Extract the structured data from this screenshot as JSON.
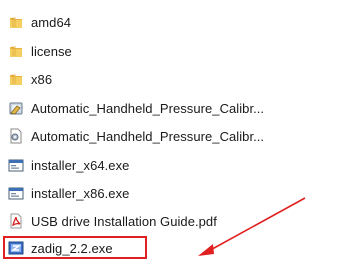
{
  "files": [
    {
      "name": "amd64",
      "icon": "folder-icon"
    },
    {
      "name": "license",
      "icon": "folder-icon"
    },
    {
      "name": "x86",
      "icon": "folder-icon"
    },
    {
      "name": "Automatic_Handheld_Pressure_Calibr...",
      "icon": "application-icon"
    },
    {
      "name": "Automatic_Handheld_Pressure_Calibr...",
      "icon": "setup-file-icon"
    },
    {
      "name": "installer_x64.exe",
      "icon": "exe-window-icon"
    },
    {
      "name": "installer_x86.exe",
      "icon": "exe-window-icon"
    },
    {
      "name": "USB drive Installation Guide.pdf",
      "icon": "pdf-icon"
    },
    {
      "name": "zadig_2.2.exe",
      "icon": "zadig-app-icon"
    }
  ],
  "colors": {
    "folder": "#f2c14e",
    "highlight_border": "#e02020",
    "arrow": "#e02020"
  }
}
